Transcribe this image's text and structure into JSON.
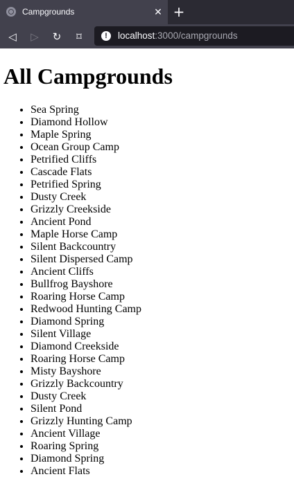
{
  "browser": {
    "tab_title": "Campgrounds",
    "url_host": "localhost",
    "url_rest": ":3000/campgrounds"
  },
  "page": {
    "heading": "All Campgrounds",
    "campgrounds": [
      "Sea Spring",
      "Diamond Hollow",
      "Maple Spring",
      "Ocean Group Camp",
      "Petrified Cliffs",
      "Cascade Flats",
      "Petrified Spring",
      "Dusty Creek",
      "Grizzly Creekside",
      "Ancient Pond",
      "Maple Horse Camp",
      "Silent Backcountry",
      "Silent Dispersed Camp",
      "Ancient Cliffs",
      "Bullfrog Bayshore",
      "Roaring Horse Camp",
      "Redwood Hunting Camp",
      "Diamond Spring",
      "Silent Village",
      "Diamond Creekside",
      "Roaring Horse Camp",
      "Misty Bayshore",
      "Grizzly Backcountry",
      "Dusty Creek",
      "Silent Pond",
      "Grizzly Hunting Camp",
      "Ancient Village",
      "Roaring Spring",
      "Diamond Spring",
      "Ancient Flats"
    ]
  }
}
